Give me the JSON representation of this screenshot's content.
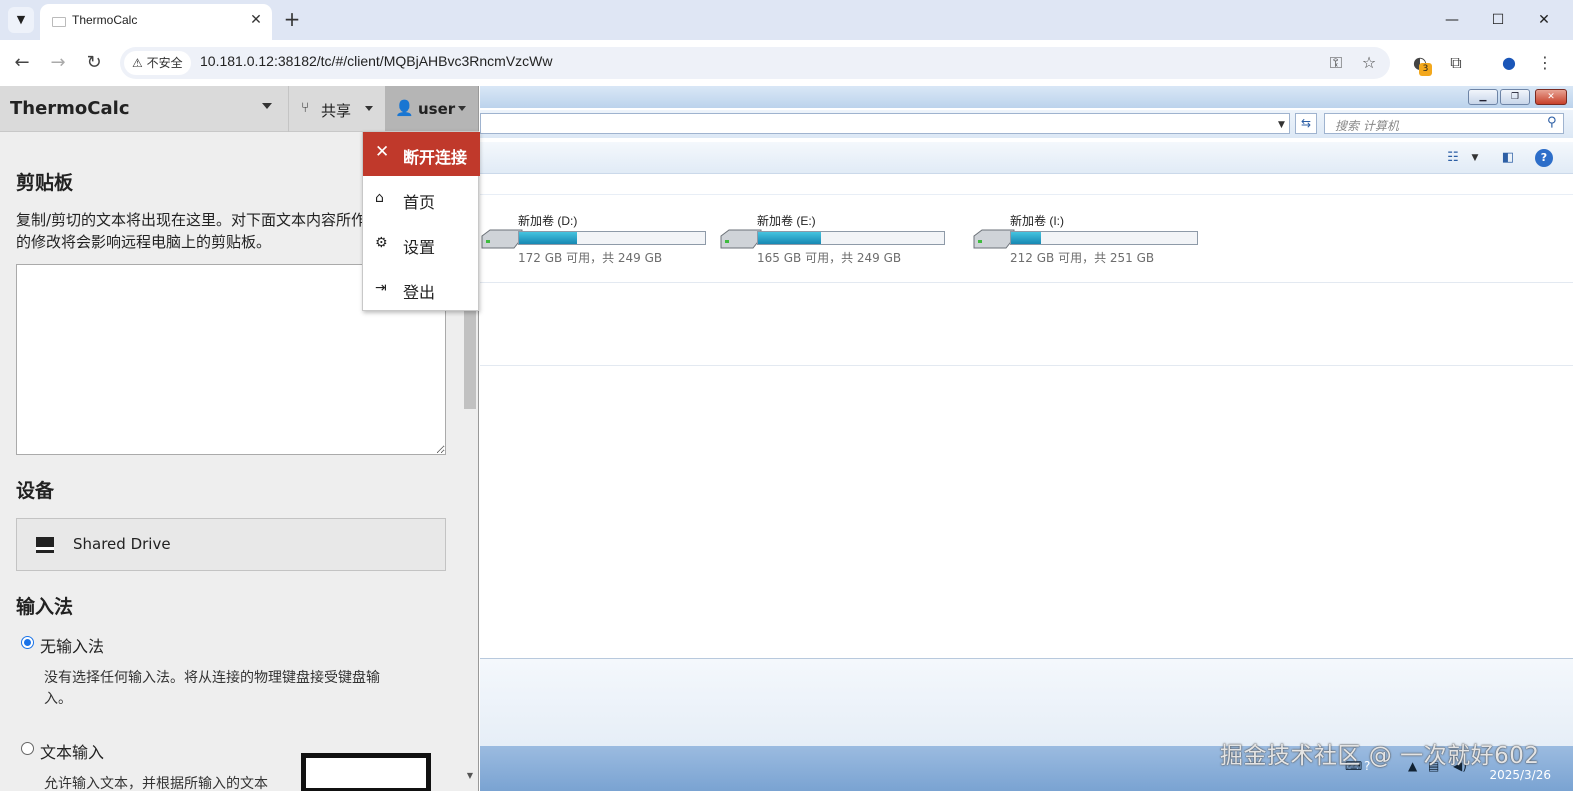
{
  "browser": {
    "tab_title": "ThermoCalc",
    "security_label": "不安全",
    "url": "10.181.0.12:38182/tc/#/client/MQBjAHBvc3RncmVzcWw",
    "extension_badge": "3"
  },
  "guac": {
    "menu_title": "ThermoCalc",
    "share_label": "共享",
    "user_label": "user",
    "dropdown": {
      "disconnect": "断开连接",
      "home": "首页",
      "settings": "设置",
      "logout": "登出"
    },
    "clipboard": {
      "title": "剪贴板",
      "description": "复制/剪切的文本将出现在这里。对下面文本内容所作的修改将会影响远程电脑上的剪贴板。",
      "text": ""
    },
    "devices": {
      "title": "设备",
      "shared_drive": "Shared Drive"
    },
    "input_method": {
      "title": "输入法",
      "options": [
        {
          "label": "无输入法",
          "desc": "没有选择任何输入法。将从连接的物理键盘接受键盘输入。",
          "checked": true
        },
        {
          "label": "文本输入",
          "desc": "允许输入文本，并根据所输入的文本",
          "checked": false
        }
      ]
    }
  },
  "remote": {
    "search_placeholder": "搜索 计算机",
    "drives": [
      {
        "name": "新加卷 (D:)",
        "size": "172 GB 可用，共 249 GB",
        "used_fraction": 0.31
      },
      {
        "name": "新加卷 (E:)",
        "size": "165 GB 可用，共 249 GB",
        "used_fraction": 0.34
      },
      {
        "name": "新加卷 (I:)",
        "size": "212 GB 可用，共 251 GB",
        "used_fraction": 0.16
      }
    ],
    "tray_date": "2025/3/26"
  },
  "watermark": "掘金技术社区 @ 一次就好602"
}
